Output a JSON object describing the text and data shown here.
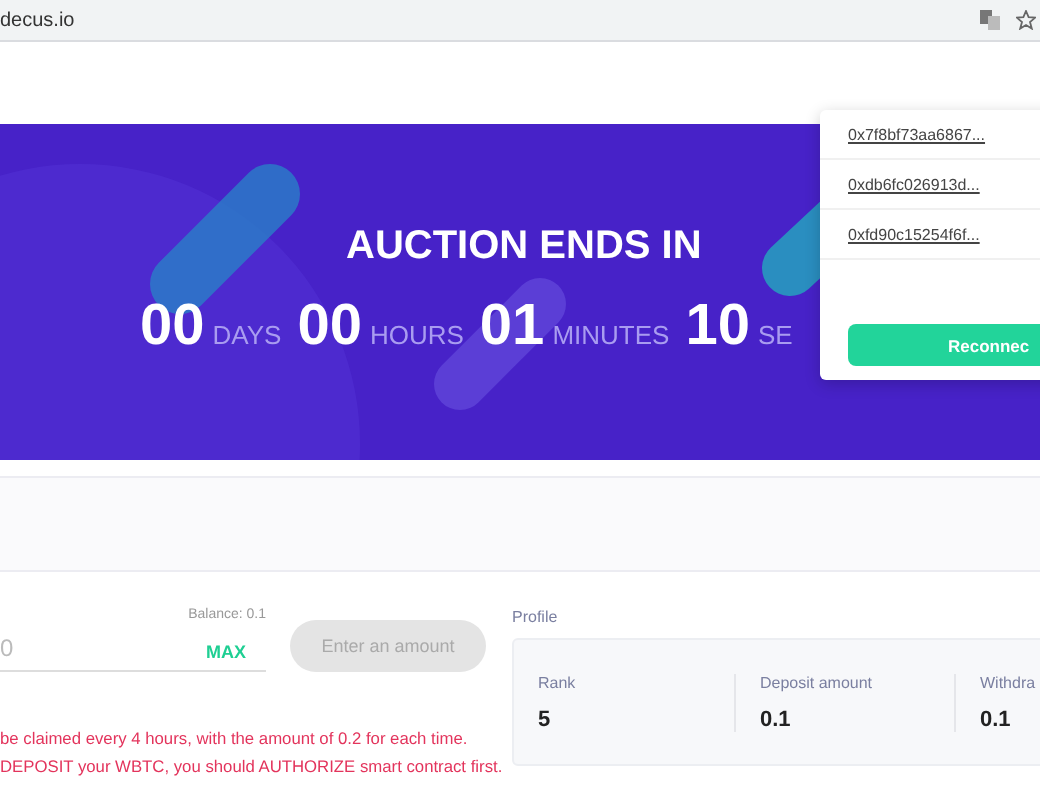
{
  "browser": {
    "url": "decus.io"
  },
  "banner": {
    "title": "AUCTION ENDS IN",
    "countdown": [
      {
        "value": "00",
        "unit": "DAYS"
      },
      {
        "value": "00",
        "unit": "HOURS"
      },
      {
        "value": "01",
        "unit": "MINUTES"
      },
      {
        "value": "10",
        "unit": "SE"
      }
    ]
  },
  "deposit": {
    "placeholder": "0",
    "balance": "Balance: 0.1",
    "max": "MAX",
    "button": "Enter an amount",
    "disabled": true,
    "notes": [
      "be claimed every 4 hours, with the amount of 0.2 for each time.",
      "DEPOSIT your WBTC, you should AUTHORIZE smart contract first."
    ]
  },
  "profile": {
    "title": "Profile",
    "stats": [
      {
        "label": "Rank",
        "value": "5"
      },
      {
        "label": "Deposit amount",
        "value": "0.1"
      },
      {
        "label": "Withdra",
        "value": "0.1"
      }
    ]
  },
  "account_popup": {
    "accounts": [
      {
        "address": "0x7f8bf73aa6867..."
      },
      {
        "address": "0xdb6fc026913d..."
      },
      {
        "address": "0xfd90c15254f6f..."
      }
    ],
    "button": "Reconnec"
  }
}
